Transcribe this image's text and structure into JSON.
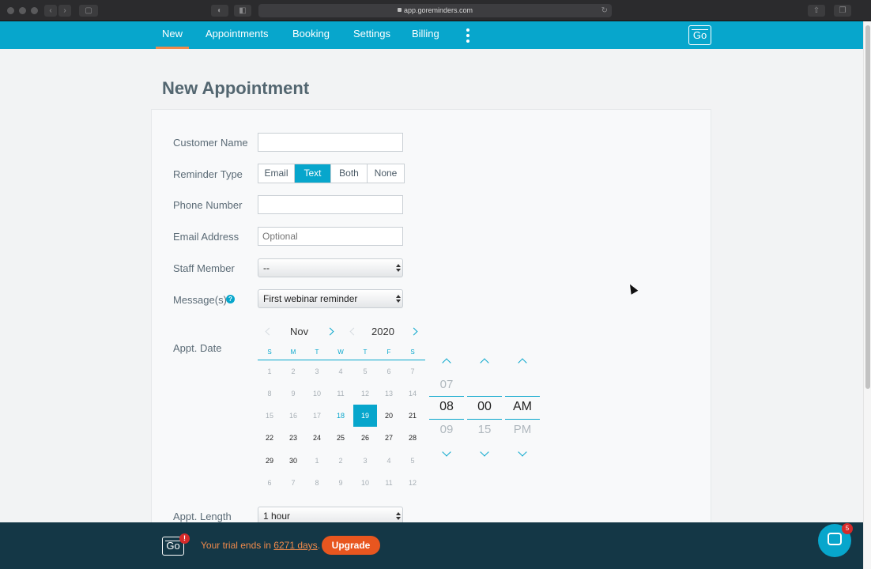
{
  "browser": {
    "url": "app.goreminders.com"
  },
  "nav": {
    "items": [
      "New",
      "Appointments",
      "Booking",
      "Settings",
      "Billing"
    ],
    "active": "New",
    "logo_text": "Go"
  },
  "page": {
    "title": "New Appointment"
  },
  "form": {
    "customer_name": {
      "label": "Customer Name",
      "value": "",
      "placeholder": ""
    },
    "reminder_type": {
      "label": "Reminder Type",
      "options": [
        "Email",
        "Text",
        "Both",
        "None"
      ],
      "selected": "Text"
    },
    "phone_number": {
      "label": "Phone Number",
      "value": "",
      "placeholder": ""
    },
    "email_address": {
      "label": "Email Address",
      "value": "",
      "placeholder": "Optional"
    },
    "staff_member": {
      "label": "Staff Member",
      "selected": "--"
    },
    "messages": {
      "label": "Message(s)",
      "help": "?",
      "selected": "First webinar reminder"
    },
    "appt_date": {
      "label": "Appt. Date"
    },
    "appt_length": {
      "label": "Appt. Length",
      "selected": "1 hour"
    }
  },
  "calendar": {
    "month": "Nov",
    "year": "2020",
    "weekdays": [
      "S",
      "M",
      "T",
      "W",
      "T",
      "F",
      "S"
    ],
    "weeks": [
      [
        "1",
        "2",
        "3",
        "4",
        "5",
        "6",
        "7"
      ],
      [
        "8",
        "9",
        "10",
        "11",
        "12",
        "13",
        "14"
      ],
      [
        "15",
        "16",
        "17",
        "18",
        "19",
        "20",
        "21"
      ],
      [
        "22",
        "23",
        "24",
        "25",
        "26",
        "27",
        "28"
      ],
      [
        "29",
        "30",
        "1",
        "2",
        "3",
        "4",
        "5"
      ],
      [
        "6",
        "7",
        "8",
        "9",
        "10",
        "11",
        "12"
      ]
    ],
    "today": "18",
    "selected": "19"
  },
  "time": {
    "hour": {
      "prev": "07",
      "current": "08",
      "next": "09"
    },
    "minute": {
      "prev": "",
      "current": "00",
      "next": "15"
    },
    "period": {
      "prev": "",
      "current": "AM",
      "next": "PM"
    }
  },
  "trial": {
    "badge": "!",
    "text_before": "Your trial ends in",
    "days": "6271 days",
    "text_after": ".",
    "upgrade_label": "Upgrade"
  },
  "chat": {
    "badge": "5"
  },
  "colors": {
    "brand": "#07a6cc",
    "accent": "#f08a4b",
    "upgrade": "#e8561f",
    "footer": "#143746"
  }
}
